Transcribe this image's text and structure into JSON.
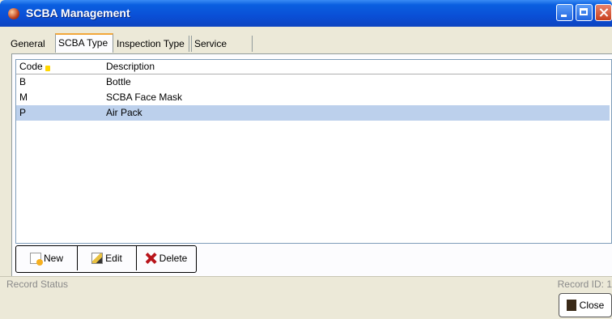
{
  "window": {
    "title": "SCBA Management"
  },
  "tabs": [
    {
      "label": "General"
    },
    {
      "label": "SCBA Type"
    },
    {
      "label": "Inspection Type"
    },
    {
      "label": "Service Type"
    }
  ],
  "grid": {
    "columns": [
      "Code",
      "Description"
    ],
    "sort_indicator": "1",
    "rows": [
      {
        "code": "B",
        "description": "Bottle"
      },
      {
        "code": "M",
        "description": "SCBA Face Mask"
      },
      {
        "code": "P",
        "description": "Air Pack",
        "selected": true
      }
    ]
  },
  "toolbar": {
    "new_label": "New",
    "edit_label": "Edit",
    "delete_label": "Delete"
  },
  "status": {
    "left": "Record Status",
    "right": "Record ID: 1"
  },
  "footer": {
    "close_label": "Close"
  },
  "icons": [
    "app-icon",
    "minimize-icon",
    "maximize-icon",
    "close-icon",
    "new-icon",
    "edit-icon",
    "delete-icon",
    "door-icon",
    "sort-icon"
  ],
  "colors": {
    "titlebar": "#0a4fd6",
    "selection": "#bcd0ec",
    "active_tab_accent": "#f2a73a"
  }
}
